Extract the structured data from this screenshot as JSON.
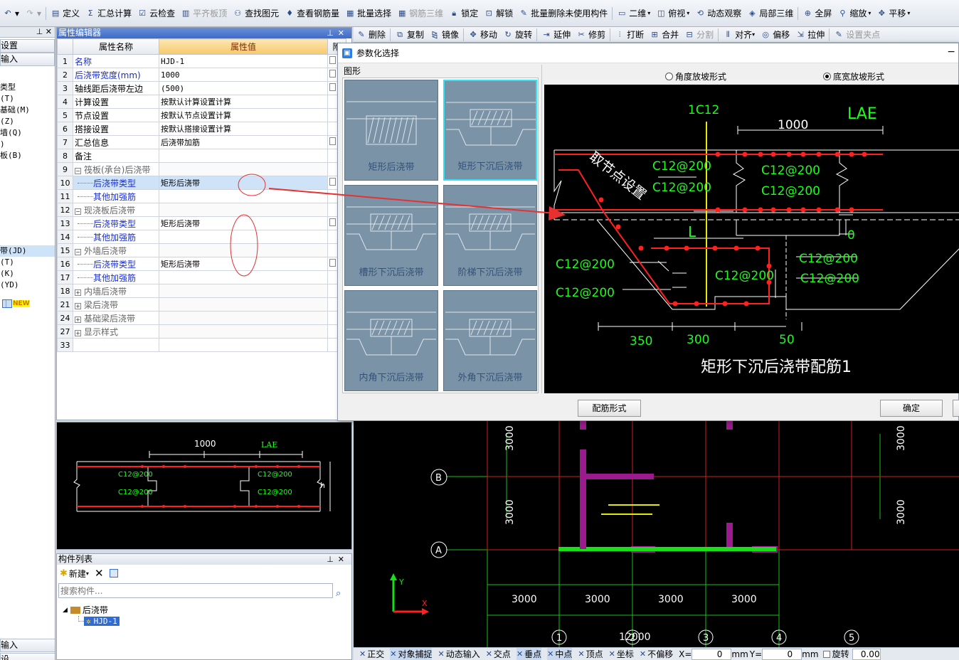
{
  "toolbar1": {
    "items": [
      {
        "label": "定义",
        "icon": "define-icon"
      },
      {
        "label": "汇总计算",
        "icon": "sigma-icon"
      },
      {
        "label": "云检查",
        "icon": "cloud-check-icon"
      },
      {
        "label": "平齐板顶",
        "icon": "align-top-icon",
        "disabled": true
      },
      {
        "label": "查找图元",
        "icon": "binoculars-icon"
      },
      {
        "label": "查看钢筋量",
        "icon": "rebar-icon"
      },
      {
        "label": "批量选择",
        "icon": "batch-select-icon"
      },
      {
        "label": "钢筋三维",
        "icon": "rebar-3d-icon",
        "disabled": true
      },
      {
        "label": "锁定",
        "icon": "lock-icon"
      },
      {
        "label": "解锁",
        "icon": "unlock-icon"
      },
      {
        "label": "批量删除未使用构件",
        "icon": "batch-delete-icon"
      },
      {
        "label": "二维",
        "icon": "2d-icon"
      },
      {
        "label": "俯视",
        "icon": "top-view-icon"
      },
      {
        "label": "动态观察",
        "icon": "orbit-icon"
      },
      {
        "label": "局部三维",
        "icon": "local-3d-icon"
      },
      {
        "label": "全屏",
        "icon": "fullscreen-icon"
      },
      {
        "label": "缩放",
        "icon": "zoom-icon"
      },
      {
        "label": "平移",
        "icon": "pan-icon"
      }
    ]
  },
  "toolbar2": {
    "items": [
      {
        "label": "删除",
        "icon": "delete-icon"
      },
      {
        "label": "复制",
        "icon": "copy-icon"
      },
      {
        "label": "镜像",
        "icon": "mirror-icon"
      },
      {
        "label": "移动",
        "icon": "move-icon"
      },
      {
        "label": "旋转",
        "icon": "rotate-icon"
      },
      {
        "label": "延伸",
        "icon": "extend-icon"
      },
      {
        "label": "修剪",
        "icon": "trim-icon"
      },
      {
        "label": "打断",
        "icon": "break-icon"
      },
      {
        "label": "合并",
        "icon": "merge-icon"
      },
      {
        "label": "分割",
        "icon": "split-icon",
        "disabled": true
      },
      {
        "label": "对齐",
        "icon": "align-icon"
      },
      {
        "label": "偏移",
        "icon": "offset-icon"
      },
      {
        "label": "拉伸",
        "icon": "stretch-icon"
      },
      {
        "label": "设置夹点",
        "icon": "grip-icon",
        "disabled": true
      }
    ]
  },
  "left_panel": {
    "btn1": "设置",
    "btn2": "输入",
    "list": [
      "类型",
      "(T)",
      "基础(M)",
      "(Z)",
      "墙(Q)",
      ")",
      "板(B)"
    ],
    "list2": [
      "带(JD)",
      "(T)",
      "(K)",
      "(YD)"
    ],
    "new_badge": "NEW",
    "bottom1": "输入",
    "bottom2": "设"
  },
  "property_editor": {
    "title": "属性编辑器",
    "col_name": "属性名称",
    "col_value": "属性值",
    "col_extra": "附",
    "rows": [
      {
        "num": "1",
        "name": "名称",
        "value": "HJD-1",
        "style": "blue"
      },
      {
        "num": "2",
        "name": "后浇带宽度(mm)",
        "value": "1000",
        "style": "blue"
      },
      {
        "num": "3",
        "name": "轴线距后浇带左边",
        "value": "(500)",
        "style": ""
      },
      {
        "num": "4",
        "name": "计算设置",
        "value": "按默认计算设置计算",
        "style": ""
      },
      {
        "num": "5",
        "name": "节点设置",
        "value": "按默认节点设置计算",
        "style": ""
      },
      {
        "num": "6",
        "name": "搭接设置",
        "value": "按默认搭接设置计算",
        "style": ""
      },
      {
        "num": "7",
        "name": "汇总信息",
        "value": "后浇带加筋",
        "style": ""
      },
      {
        "num": "8",
        "name": "备注",
        "value": "",
        "style": ""
      },
      {
        "num": "9",
        "name": "筏板(承台)后浇带",
        "value": "",
        "style": "group-minus"
      },
      {
        "num": "10",
        "name": "后浇带类型",
        "value": "矩形后浇带",
        "style": "child-selected"
      },
      {
        "num": "11",
        "name": "其他加强筋",
        "value": "",
        "style": "child"
      },
      {
        "num": "12",
        "name": "现浇板后浇带",
        "value": "",
        "style": "group-minus"
      },
      {
        "num": "13",
        "name": "后浇带类型",
        "value": "矩形后浇带",
        "style": "child"
      },
      {
        "num": "14",
        "name": "其他加强筋",
        "value": "",
        "style": "child"
      },
      {
        "num": "15",
        "name": "外墙后浇带",
        "value": "",
        "style": "group-minus"
      },
      {
        "num": "16",
        "name": "后浇带类型",
        "value": "矩形后浇带",
        "style": "child"
      },
      {
        "num": "17",
        "name": "其他加强筋",
        "value": "",
        "style": "child"
      },
      {
        "num": "18",
        "name": "内墙后浇带",
        "value": "",
        "style": "group-plus"
      },
      {
        "num": "21",
        "name": "梁后浇带",
        "value": "",
        "style": "group-plus"
      },
      {
        "num": "24",
        "name": "基础梁后浇带",
        "value": "",
        "style": "group-plus"
      },
      {
        "num": "27",
        "name": "显示样式",
        "value": "",
        "style": "group-plus"
      },
      {
        "num": "33",
        "name": "",
        "value": "",
        "style": "empty"
      }
    ]
  },
  "preview": {
    "dim_width": "1000",
    "dim_lae": "LAE",
    "rebar_labels": [
      "C12@200",
      "C12@200",
      "C12@200",
      "C12@200"
    ],
    "h_label": "h"
  },
  "component_list": {
    "title": "构件列表",
    "new_label": "新建",
    "search_placeholder": "搜索构件...",
    "tree_root": "后浇带",
    "tree_child": "HJD-1"
  },
  "dialog": {
    "title": "参数化选择",
    "group_label": "图形",
    "radio_angle": "角度放坡形式",
    "radio_width": "底宽放坡形式",
    "shapes": [
      {
        "label": "矩形后浇带",
        "selected": false
      },
      {
        "label": "矩形下沉后浇带",
        "selected": true
      },
      {
        "label": "槽形下沉后浇带",
        "selected": false
      },
      {
        "label": "阶梯下沉后浇带",
        "selected": false
      },
      {
        "label": "内角下沉后浇带",
        "selected": false
      },
      {
        "label": "外角下沉后浇带",
        "selected": false
      }
    ],
    "big": {
      "t_1c12": "1C12",
      "t_1000": "1000",
      "t_lae": "LAE",
      "t_node": "取节点设置",
      "t_l": "L",
      "t_0": "0",
      "rebar": [
        "C12@200",
        "C12@200",
        "C12@200",
        "C12@200",
        "C12@200",
        "C12@200",
        "C12@200",
        "C12@200",
        "C12@200"
      ],
      "d350": "350",
      "d300": "300",
      "d50": "50",
      "caption": "矩形下沉后浇带配筋1"
    },
    "btn_rebar": "配筋形式",
    "btn_ok": "确定"
  },
  "cad": {
    "dims_v": [
      "3000",
      "3000",
      "3000",
      "3000"
    ],
    "axes_letter": [
      "B",
      "A"
    ],
    "dims_h": [
      "3000",
      "3000",
      "3000",
      "3000"
    ],
    "total": "12000",
    "axes_num": [
      "1",
      "2",
      "3",
      "4",
      "5"
    ],
    "y_label": "Y",
    "x_label": "X"
  },
  "statusbar": {
    "items": [
      "正交",
      "对象捕捉",
      "动态输入",
      "交点",
      "垂点",
      "中点",
      "顶点",
      "坐标",
      "不偏移"
    ],
    "x_label": "X=",
    "x_value": "0",
    "y_label": "Y=",
    "y_value": "0",
    "unit": "mm",
    "rotate_label": "旋转",
    "rotate_value": "0.00"
  },
  "colors": {
    "cad_red": "#ff2020",
    "cad_green": "#18ff18",
    "cad_white": "#ffffff",
    "cad_magenta": "#9b1a8e",
    "thumb_bg": "#7b93a6",
    "selected_border": "#38e0f0"
  }
}
